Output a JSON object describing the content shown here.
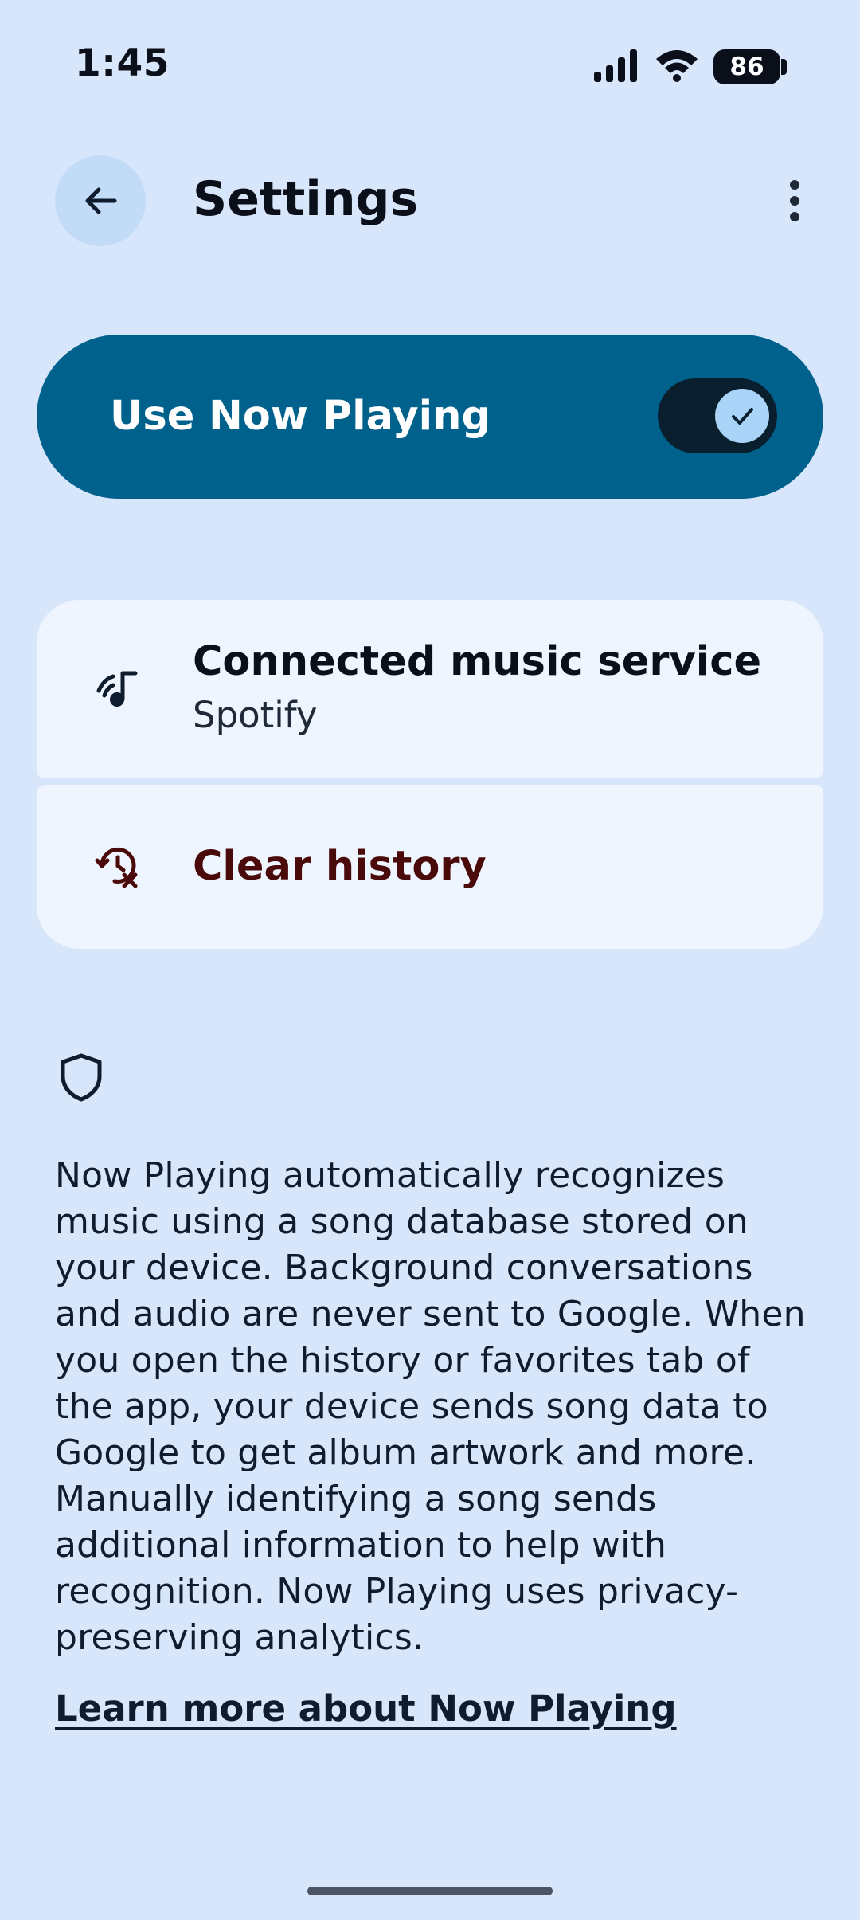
{
  "status_bar": {
    "time": "1:45",
    "battery": "86",
    "icons": [
      "signal-icon",
      "wifi-icon",
      "battery-icon"
    ]
  },
  "app_bar": {
    "title": "Settings",
    "back_icon": "arrow-back-icon",
    "more_icon": "more-vert-icon"
  },
  "main_toggle": {
    "label": "Use Now Playing",
    "enabled": true
  },
  "items": [
    {
      "title": "Connected music service",
      "subtitle": "Spotify",
      "icon": "music-service-icon"
    },
    {
      "title": "Clear history",
      "icon": "history-clear-icon"
    }
  ],
  "info": {
    "icon": "shield-icon",
    "text": "Now Playing automatically recognizes music using a song database stored on your device. Background conversations and audio are never sent to Google. When you open the history or favorites tab of the app, your device sends song data to Google to get album artwork and more. Manually identifying a song sends additional information to help with recognition. Now Playing uses privacy-preserving analytics.",
    "link": "Learn more about Now Playing"
  },
  "colors": {
    "background": "#d8e6fb",
    "toggle_card": "#00628c",
    "list_card": "#eef5fe",
    "danger_text": "#4a0a0a"
  }
}
